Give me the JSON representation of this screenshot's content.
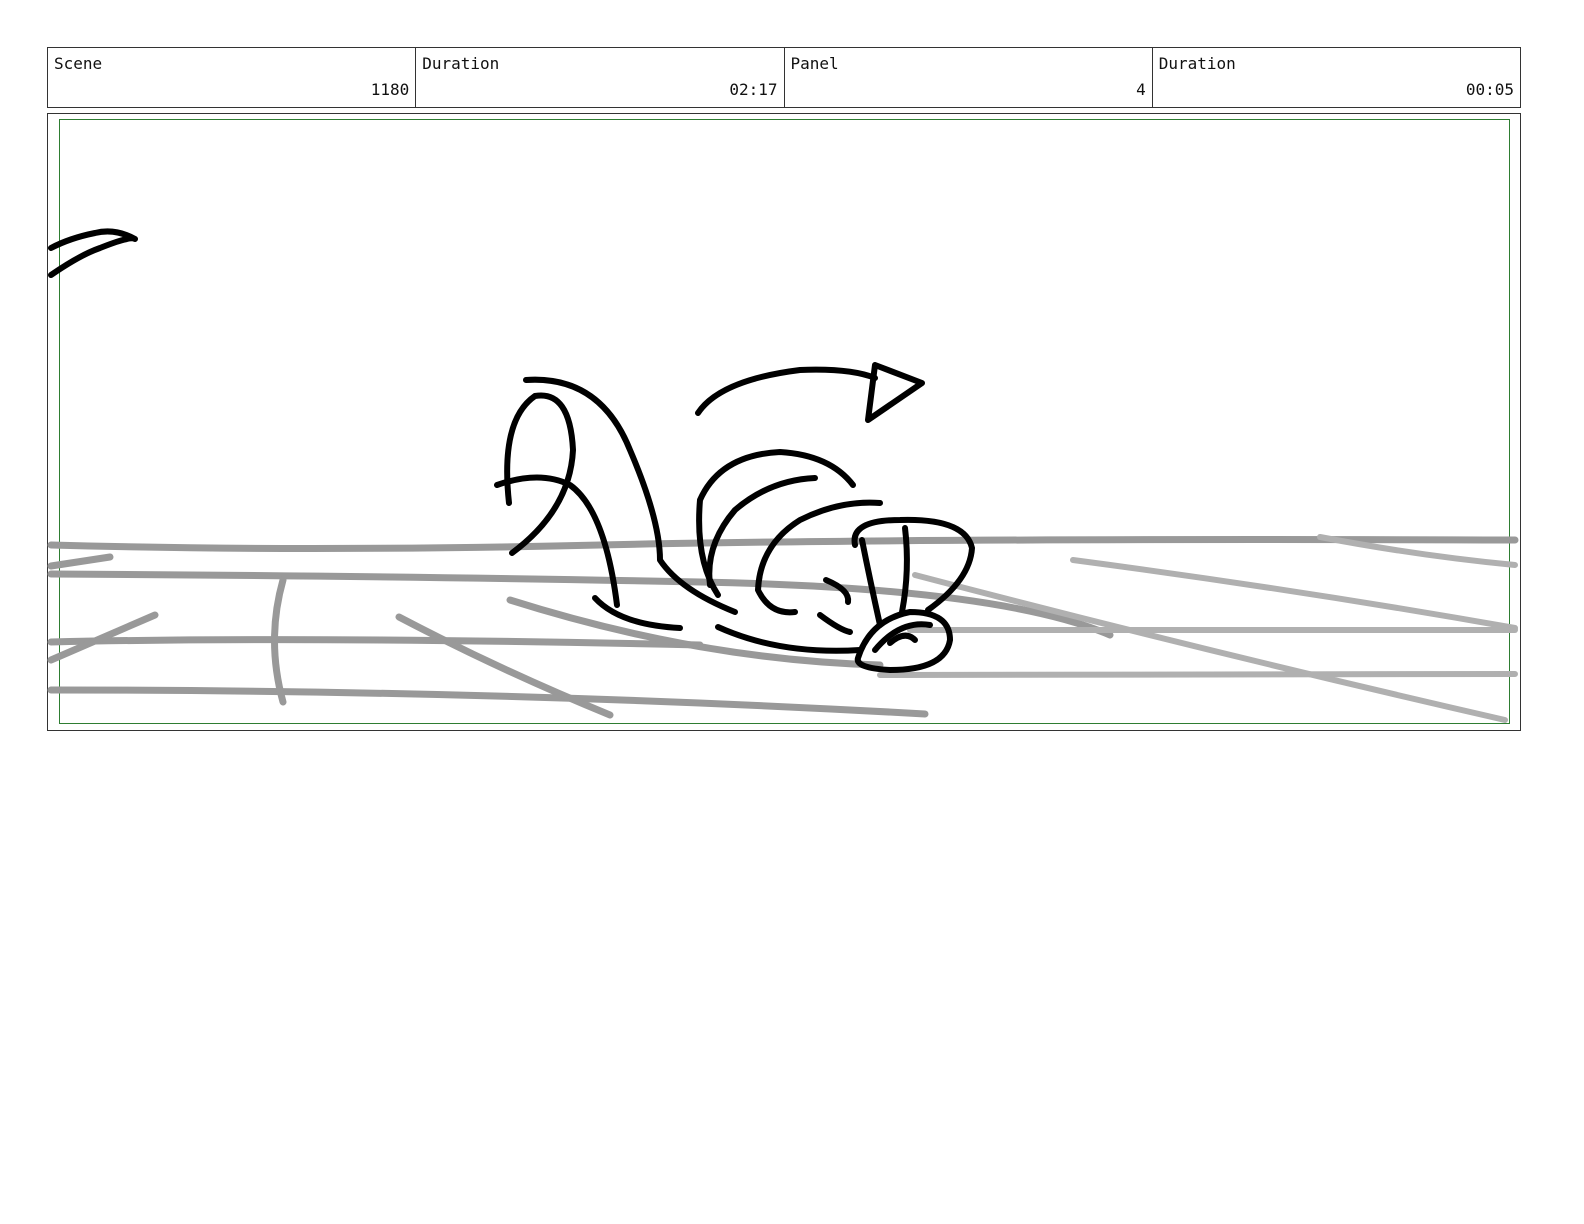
{
  "header": {
    "cells": [
      {
        "label": "Scene",
        "value": "1180"
      },
      {
        "label": "Duration",
        "value": "02:17"
      },
      {
        "label": "Panel",
        "value": "4"
      },
      {
        "label": "Duration",
        "value": "00:05"
      }
    ]
  },
  "colors": {
    "border": "#333333",
    "safe_area": "#2e7d32",
    "sketch_ink": "#000000",
    "sketch_rough": "#999999"
  }
}
